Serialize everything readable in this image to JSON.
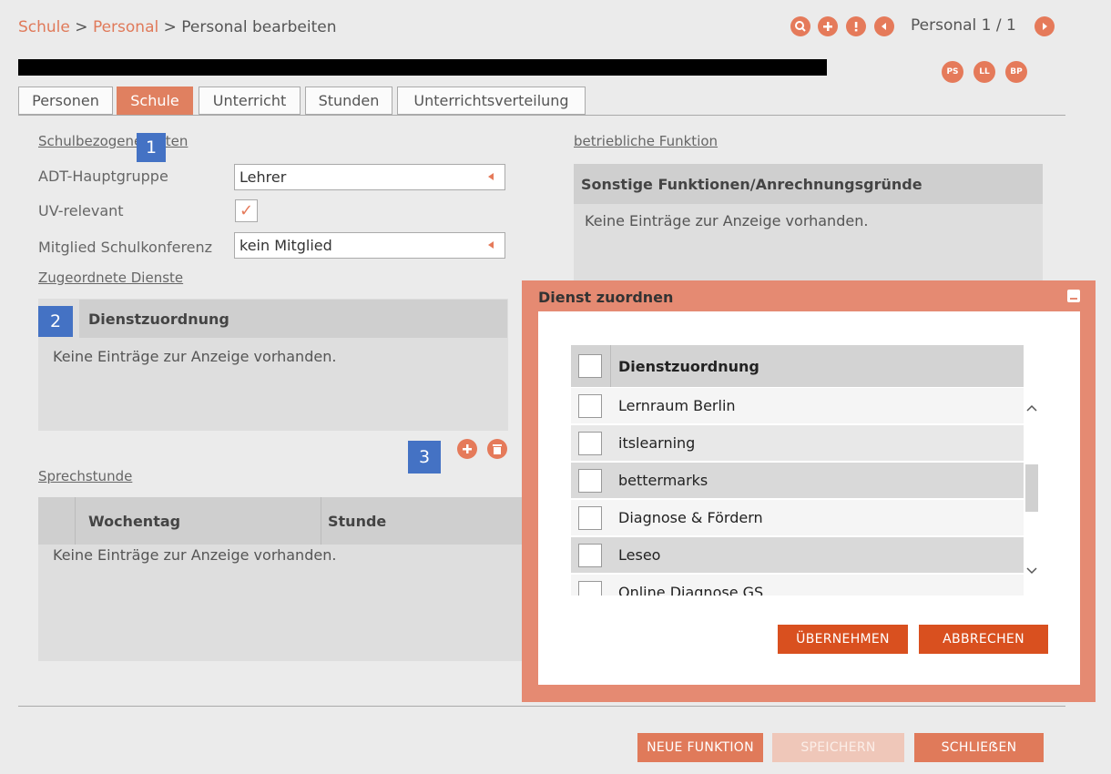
{
  "breadcrumb": {
    "part1": "Schule",
    "sep": " > ",
    "part2": "Personal",
    "part3": "Personal bearbeiten"
  },
  "nav": {
    "counter": "Personal 1 / 1"
  },
  "badges": [
    "PS",
    "LL",
    "BP"
  ],
  "tabs": [
    "Personen",
    "Schule",
    "Unterricht",
    "Stunden",
    "Unterrichtsverteilung"
  ],
  "active_tab": "Schule",
  "school": {
    "link": "Schulbezogene Daten",
    "adt_label": "ADT-Hauptgruppe",
    "adt_value": "Lehrer",
    "uv_label": "UV-relevant",
    "uv_checked": "✓",
    "schulkonferenz_label": "Mitglied Schulkonferenz",
    "schulkonferenz_value": "kein Mitglied"
  },
  "services": {
    "link": "Zugeordnete Dienste",
    "header": "Dienstzuordnung",
    "empty": "Keine Einträge zur Anzeige vorhanden."
  },
  "office_hours": {
    "link": "Sprechstunde",
    "col1": "Wochentag",
    "col2": "Stunde",
    "empty": "Keine Einträge zur Anzeige vorhanden."
  },
  "function": {
    "link": "betriebliche Funktion",
    "header": "Sonstige Funktionen/Anrechnungsgründe",
    "empty": "Keine Einträge zur Anzeige vorhanden."
  },
  "markers": [
    "1",
    "2",
    "3"
  ],
  "modal": {
    "title": "Dienst zuordnen",
    "header": "Dienstzuordnung",
    "items": [
      "Lernraum Berlin",
      "itslearning",
      "bettermarks",
      "Diagnose & Fördern",
      "Leseo",
      "Online Diagnose GS"
    ],
    "accept": "ÜBERNEHMEN",
    "cancel": "ABBRECHEN"
  },
  "footer": {
    "new_function": "NEUE FUNKTION",
    "save": "SPEICHERN",
    "close": "SCHLIEẞEN"
  },
  "colors": {
    "accent": "#e57a5a",
    "button_dark": "#d9501f",
    "marker": "#4472c4",
    "modal_border": "#e58a72"
  }
}
